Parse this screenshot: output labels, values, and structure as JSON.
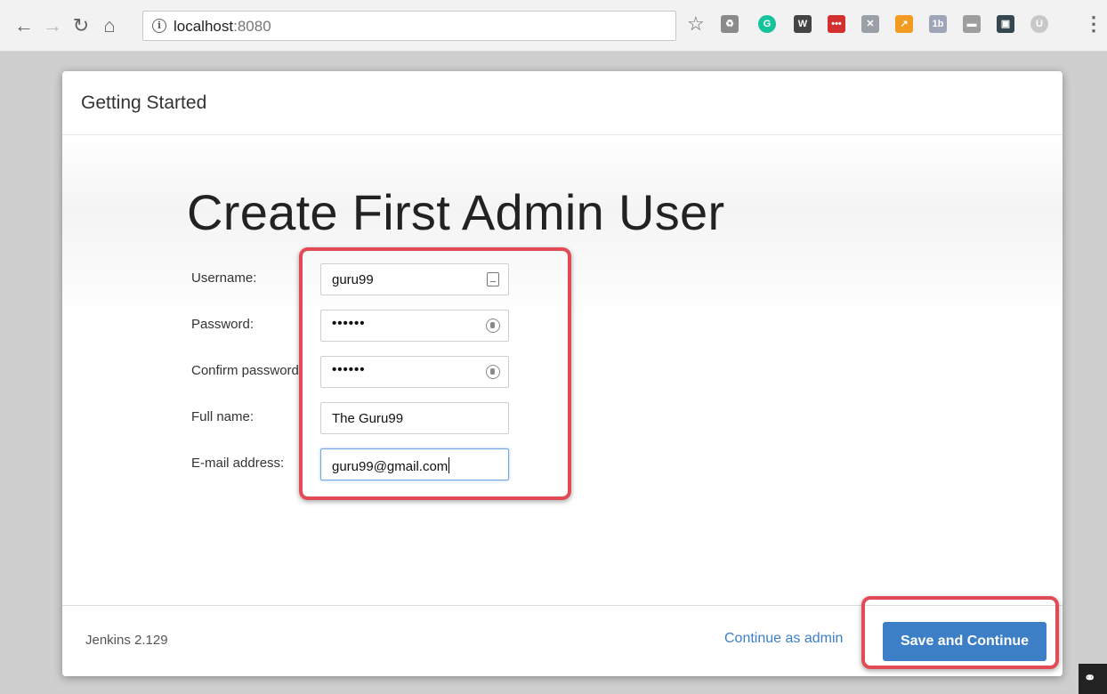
{
  "browser": {
    "url_host": "localhost",
    "url_port": ":8080",
    "icons": [
      "back-icon",
      "forward-icon",
      "reload-icon",
      "home-icon",
      "info-icon",
      "star-icon",
      "menu-icon"
    ]
  },
  "dialog": {
    "title": "Getting Started",
    "heading": "Create First Admin User",
    "fields": {
      "username": {
        "label": "Username:",
        "value": "guru99"
      },
      "password": {
        "label": "Password:",
        "value": "••••••"
      },
      "confirm": {
        "label": "Confirm password:",
        "value": "••••••"
      },
      "fullname": {
        "label": "Full name:",
        "value": "The Guru99"
      },
      "email": {
        "label": "E-mail address:",
        "value": "guru99@gmail.com"
      }
    },
    "footer": {
      "version": "Jenkins 2.129",
      "continue_admin": "Continue as admin",
      "save": "Save and Continue"
    }
  },
  "colors": {
    "accent": "#3d7fc6",
    "highlight": "#e04b55"
  }
}
